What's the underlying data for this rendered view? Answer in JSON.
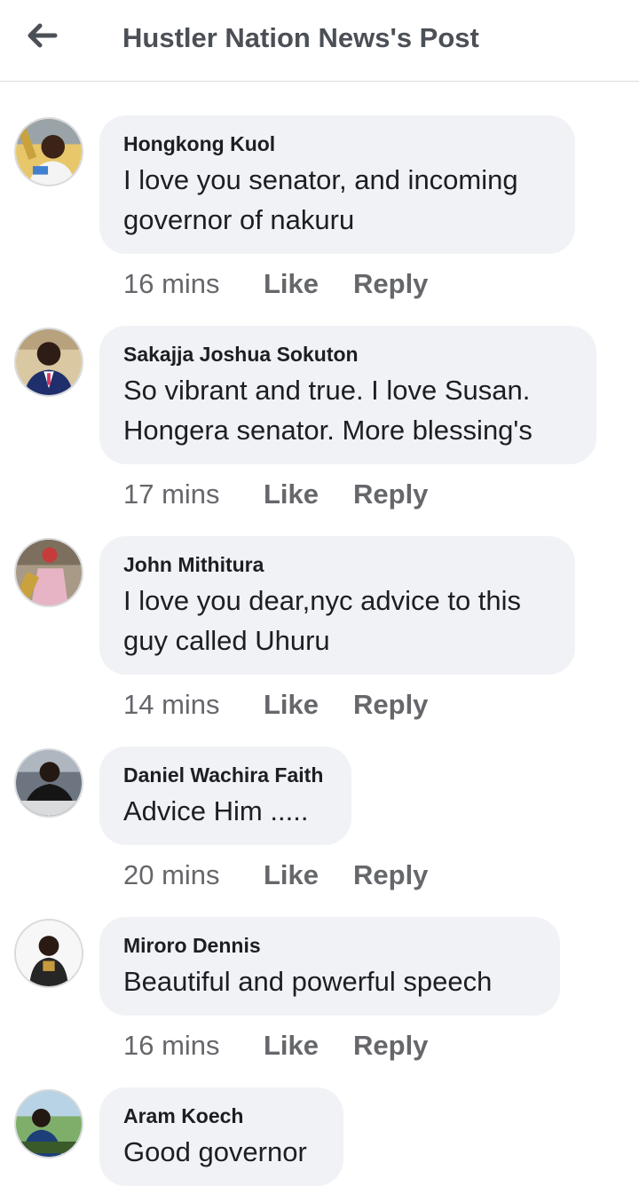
{
  "header": {
    "title": "Hustler Nation News's Post"
  },
  "comments": [
    {
      "author": "Hongkong Kuol",
      "lines": [
        "I love you senator, and incoming",
        "governor of nakuru"
      ],
      "time": "16 mins",
      "like": "Like",
      "reply": "Reply"
    },
    {
      "author": "Sakajja Joshua Sokuton",
      "lines": [
        "So vibrant and true.  I love Susan.",
        "Hongera senator. More blessing's"
      ],
      "time": "17 mins",
      "like": "Like",
      "reply": "Reply"
    },
    {
      "author": "John Mithitura",
      "lines": [
        "I love you dear,nyc advice to this",
        "guy called Uhuru"
      ],
      "time": "14 mins",
      "like": "Like",
      "reply": "Reply"
    },
    {
      "author": "Daniel Wachira Faith",
      "lines": [
        "Advice Him ....."
      ],
      "time": "20 mins",
      "like": "Like",
      "reply": "Reply"
    },
    {
      "author": "Miroro Dennis",
      "lines": [
        "Beautiful and powerful speech"
      ],
      "time": "16 mins",
      "like": "Like",
      "reply": "Reply"
    },
    {
      "author": "Aram Koech",
      "lines": [
        "Good governor"
      ]
    }
  ]
}
